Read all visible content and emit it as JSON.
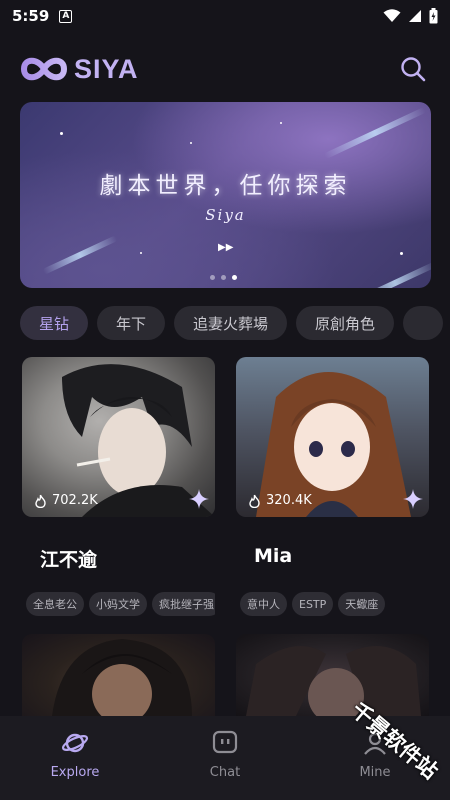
{
  "status_bar": {
    "time": "5:59",
    "a_label": "A"
  },
  "header": {
    "app_name": "SIYA"
  },
  "banner": {
    "title": "劇本世界，任你探索",
    "subtitle": "Siya",
    "arrow": "▶▶",
    "page_count": 3,
    "active_page": 3
  },
  "categories": [
    {
      "label": "星钻",
      "active": true
    },
    {
      "label": "年下",
      "active": false
    },
    {
      "label": "追妻火葬場",
      "active": false
    },
    {
      "label": "原創角色",
      "active": false
    }
  ],
  "cards": [
    {
      "name": "江不逾",
      "likes": "702.2K",
      "tags": [
        "全息老公",
        "小妈文学",
        "疯批继子强"
      ]
    },
    {
      "name": "Mia",
      "likes": "320.4K",
      "tags": [
        "意中人",
        "ESTP",
        "天蠍座"
      ]
    }
  ],
  "bottom_nav": [
    {
      "label": "Explore",
      "icon": "planet-icon",
      "active": true
    },
    {
      "label": "Chat",
      "icon": "chat-icon",
      "active": false
    },
    {
      "label": "Mine",
      "icon": "profile-icon",
      "active": false
    }
  ],
  "watermark": "千景软件站",
  "colors": {
    "accent": "#b8a9f0",
    "background": "#15141a",
    "chip": "#2b2a31"
  }
}
